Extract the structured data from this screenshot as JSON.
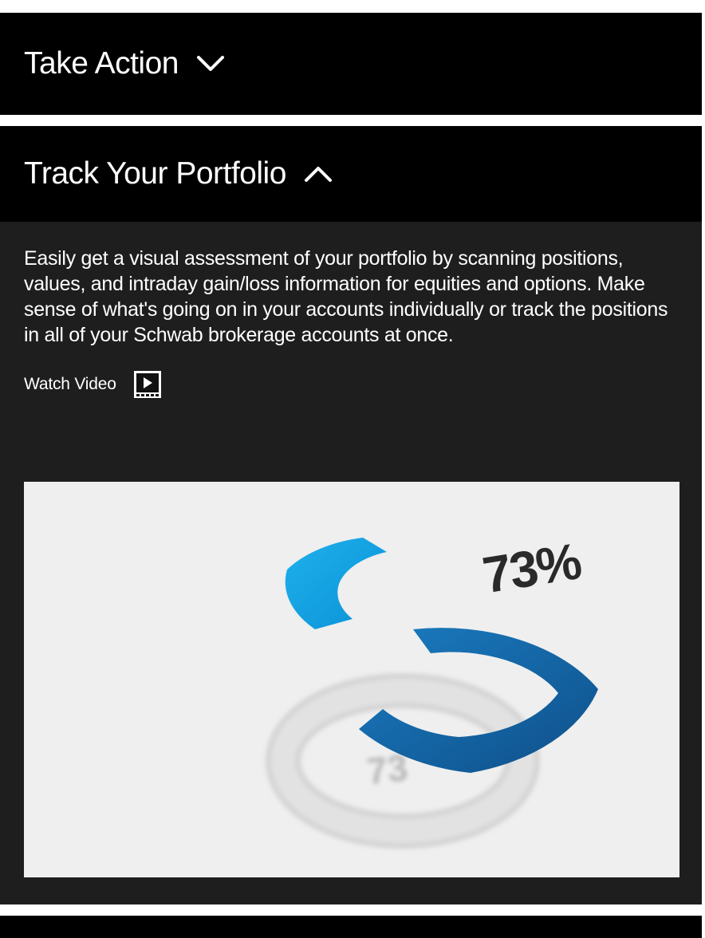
{
  "accordion": {
    "take_action": {
      "title": "Take Action",
      "state": "collapsed",
      "icon": "chevron-down-icon"
    },
    "track_portfolio": {
      "title": "Track Your Portfolio",
      "state": "expanded",
      "icon": "chevron-up-icon",
      "description": "Easily get a visual assessment of your portfolio by scanning positions, values, and intraday gain/loss information for equities and options. Make sense of what's going on in your accounts individually or track the positions in all of your Schwab brokerage accounts at once.",
      "watch_video_label": "Watch Video",
      "video_icon": "video-play-icon",
      "illustration": {
        "percent_label": "73%",
        "reflection_label": "73",
        "colors": {
          "light_blue": "#0aa0e0",
          "dark_blue": "#1469a8",
          "background": "#efefef"
        }
      }
    }
  },
  "colors": {
    "header_bg": "#000000",
    "panel_bg": "#1e1e1e",
    "text": "#ffffff"
  }
}
